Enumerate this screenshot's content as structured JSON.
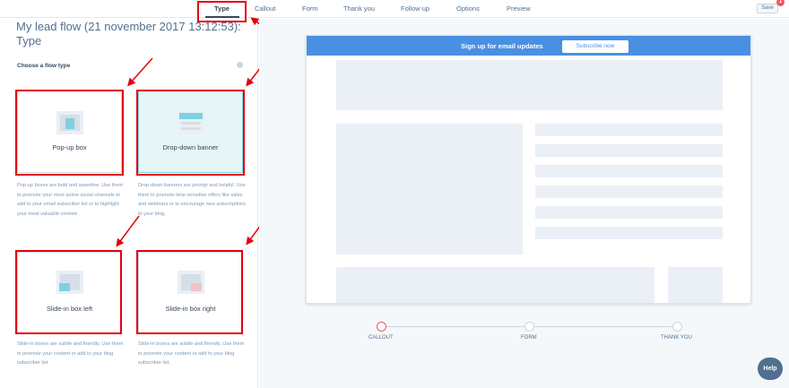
{
  "tabs": [
    {
      "label": "Type"
    },
    {
      "label": "Callout"
    },
    {
      "label": "Form"
    },
    {
      "label": "Thank you"
    },
    {
      "label": "Follow up"
    },
    {
      "label": "Options"
    },
    {
      "label": "Preview"
    }
  ],
  "save_label": "Save",
  "notification_count": "1",
  "page_title": "My lead flow (21 november 2017 13:12:53): Type",
  "choose_label": "Choose a flow type",
  "cards": [
    {
      "label": "Pop-up box",
      "description": "Pop-up boxes are bold and assertive. Use them to promote your most active social channels to add to your email subscriber list or to highlight your most valuable content."
    },
    {
      "label": "Drop-down banner",
      "description": "Drop-down banners are prompt and helpful. Use them to promote time-sensitive offers like sales and webinars or to encourage new subscriptions to your blog."
    },
    {
      "label": "Slide-in box left",
      "description": "Slide-in boxes are subtle and friendly. Use them to promote your content or add to your blog subscriber list."
    },
    {
      "label": "Slide-in box right",
      "description": "Slide-in boxes are subtle and friendly. Use them to promote your content or add to your blog subscriber list."
    }
  ],
  "preview": {
    "banner_text": "Sign up for email updates",
    "banner_button": "Subscribe now"
  },
  "steps": [
    {
      "label": "CALLOUT"
    },
    {
      "label": "FORM"
    },
    {
      "label": "THANK YOU"
    }
  ],
  "help_label": "Help",
  "colors": {
    "accent": "#4990e2",
    "highlight": "#e3000f",
    "selected_card": "#e5f5f8",
    "step_active": "#f2545b"
  }
}
